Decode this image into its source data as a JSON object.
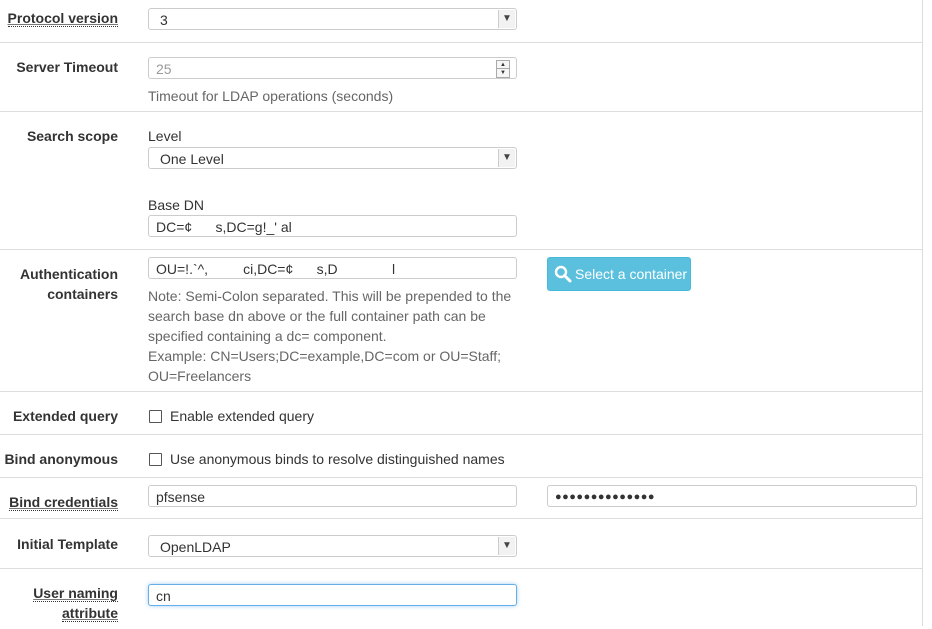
{
  "protocol": {
    "label": "Protocol version",
    "value": "3"
  },
  "timeout": {
    "label": "Server Timeout",
    "value": "25",
    "help": "Timeout for LDAP operations (seconds)"
  },
  "scope": {
    "label": "Search scope",
    "level_label": "Level",
    "level_value": "One Level",
    "basedn_label": "Base DN",
    "basedn_value": "DC=¢      s,DC=g!_' al"
  },
  "auth": {
    "label_line1": "Authentication",
    "label_line2": "containers",
    "value": "OU=!.`^,         ci,DC=¢      s,D              l",
    "button_label": "Select a container",
    "note_line1": "Note: Semi-Colon separated. This will be prepended to the",
    "note_line2": "search base dn above or the full container path can be",
    "note_line3": "specified containing a dc= component.",
    "note_line4": "Example: CN=Users;DC=example,DC=com or OU=Staff;",
    "note_line5": "OU=Freelancers"
  },
  "extended": {
    "label": "Extended query",
    "checkbox_label": "Enable extended query",
    "checked": false
  },
  "anon": {
    "label": "Bind anonymous",
    "checkbox_label": "Use anonymous binds to resolve distinguished names",
    "checked": false
  },
  "bind": {
    "label": "Bind credentials",
    "user_value": "pfsense",
    "password_value": "●●●●●●●●●●●●●●"
  },
  "template": {
    "label": "Initial Template",
    "value": "OpenLDAP"
  },
  "naming": {
    "label_line1": "User naming",
    "label_line2": "attribute",
    "value": "cn"
  },
  "icons": {
    "arrow": "chevron-down-icon",
    "search": "search-icon"
  },
  "colors": {
    "button": "#5bc0de",
    "focus": "#66afe9"
  }
}
